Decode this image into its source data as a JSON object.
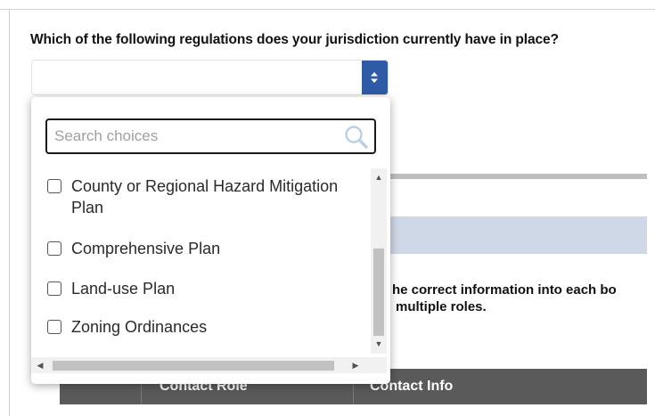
{
  "form": {
    "question": "Which of the following regulations does your jurisdiction currently have in place?"
  },
  "dropdown": {
    "search_placeholder": "Search choices",
    "options": [
      {
        "line1": "County or Regional Hazard Mitigation",
        "line2": "Plan",
        "checked": false
      },
      {
        "line1": "Comprehensive Plan",
        "checked": false
      },
      {
        "line1": "Land-use Plan",
        "checked": false
      },
      {
        "line1": "Zoning Ordinances",
        "checked": false
      }
    ]
  },
  "background": {
    "instructions_line1": "he correct information into each bo",
    "instructions_line2": "multiple roles."
  },
  "table": {
    "headers": [
      "Contact Role",
      "Contact Info"
    ]
  },
  "colors": {
    "select_button": "#2f5ba6",
    "table_header": "#5a5a5a",
    "band": "#cfd8e6"
  }
}
